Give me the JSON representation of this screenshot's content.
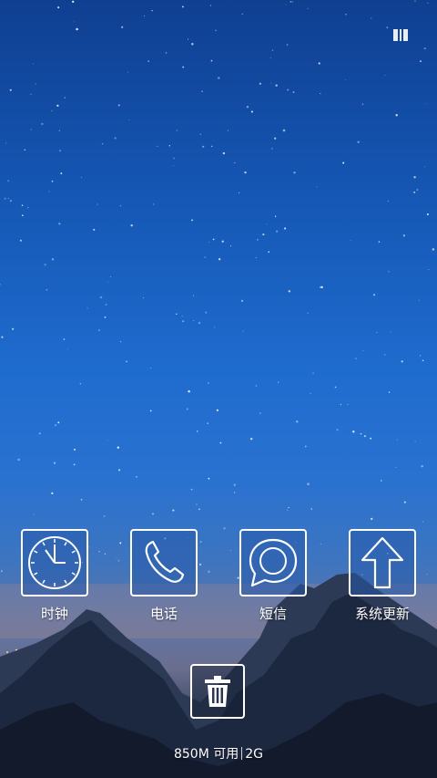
{
  "status_bar": {
    "icon": "battery-icon"
  },
  "apps": [
    {
      "label": "时钟",
      "icon": "clock-icon"
    },
    {
      "label": "电话",
      "icon": "phone-icon"
    },
    {
      "label": "短信",
      "icon": "message-icon"
    },
    {
      "label": "系统更新",
      "icon": "arrow-up-icon"
    }
  ],
  "trash": {
    "icon": "trash-icon"
  },
  "memory": {
    "free": "850M 可用",
    "network": "2G"
  },
  "colors": {
    "icon_stroke": "#ffffff",
    "tile_fill": "#285aaa"
  }
}
